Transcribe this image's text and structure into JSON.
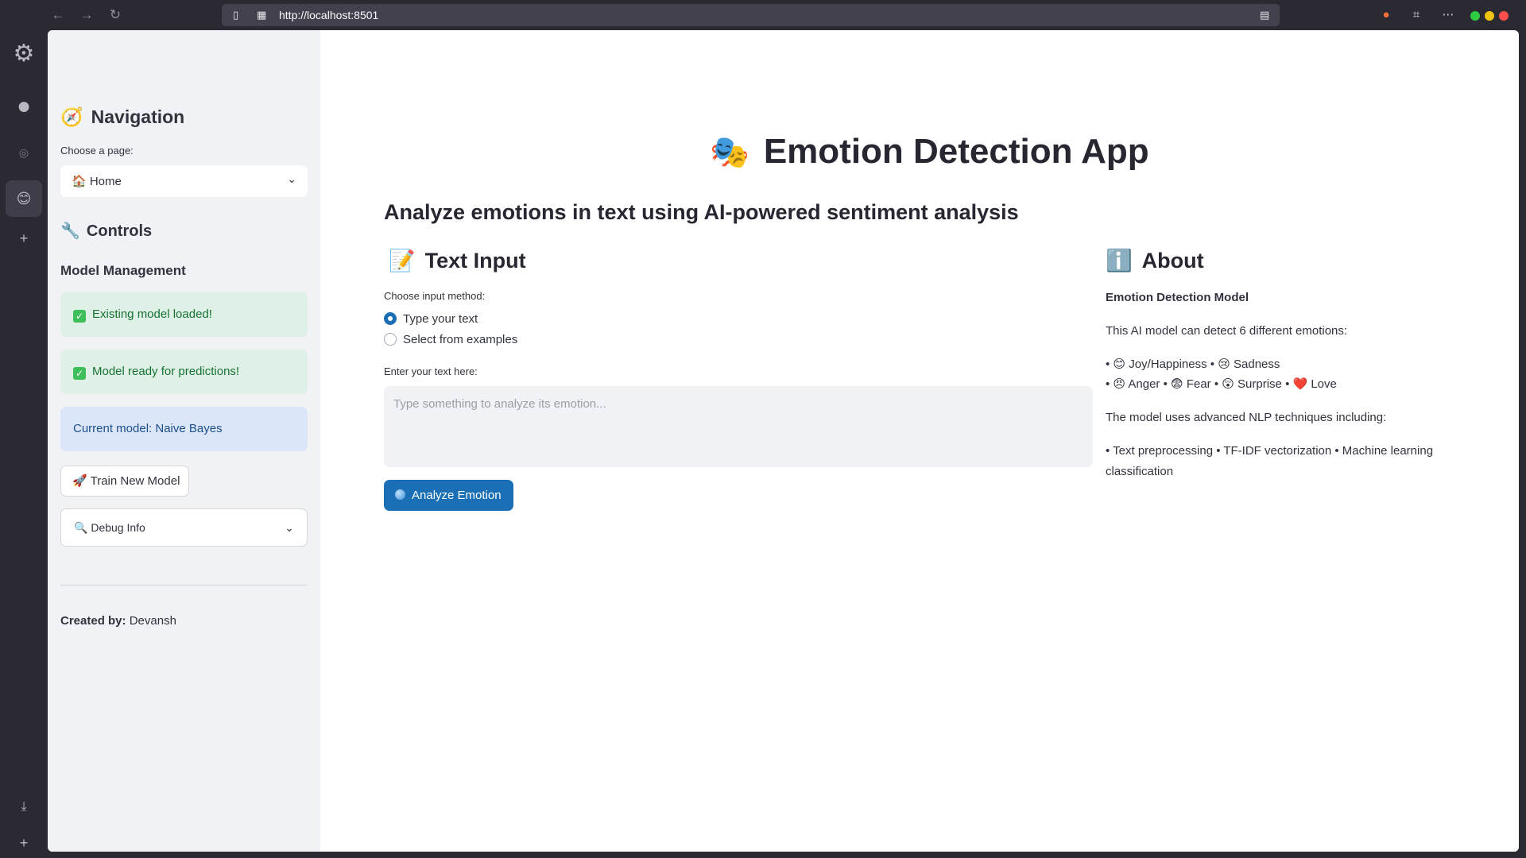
{
  "browser": {
    "url": "http://localhost:8501"
  },
  "sidebar": {
    "navigation_title": "Navigation",
    "navigation_emoji": "🧭",
    "choose_page_label": "Choose a page:",
    "page_select_value": "🏠 Home",
    "controls_title": "Controls",
    "controls_emoji": "🔧",
    "model_management_title": "Model Management",
    "alerts": [
      {
        "text": "Existing model loaded!",
        "type": "success"
      },
      {
        "text": "Model ready for predictions!",
        "type": "success"
      },
      {
        "text": "Current model: Naive Bayes",
        "type": "info"
      }
    ],
    "train_button_label": "Train New Model",
    "train_button_emoji": "🚀",
    "debug_expander_label": "Debug Info",
    "debug_expander_emoji": "🔍",
    "created_by_label": "Created by:",
    "created_by_name": "Devansh"
  },
  "main": {
    "title": "Emotion Detection App",
    "title_emoji": "🎭",
    "subtitle": "Analyze emotions in text using AI-powered sentiment analysis",
    "text_input": {
      "heading": "Text Input",
      "heading_emoji": "📝",
      "input_method_label": "Choose input method:",
      "options": [
        "Type your text",
        "Select from examples"
      ],
      "selected_option": "Type your text",
      "textarea_label": "Enter your text here:",
      "textarea_placeholder": "Type something to analyze its emotion...",
      "analyze_button_label": "Analyze Emotion"
    },
    "about": {
      "heading": "About",
      "heading_emoji": "ℹ️",
      "model_title": "Emotion Detection Model",
      "intro": "This AI model can detect 6 different emotions:",
      "emotions_line1": "• 😊 Joy/Happiness • 😢 Sadness",
      "emotions_line2": "• 😠 Anger • 😨 Fear • 😲 Surprise • ❤️ Love",
      "techniques_intro": "The model uses advanced NLP techniques including:",
      "techniques_line1": "• Text preprocessing • TF-IDF vectorization • Machine learning",
      "techniques_line2": "classification"
    }
  }
}
